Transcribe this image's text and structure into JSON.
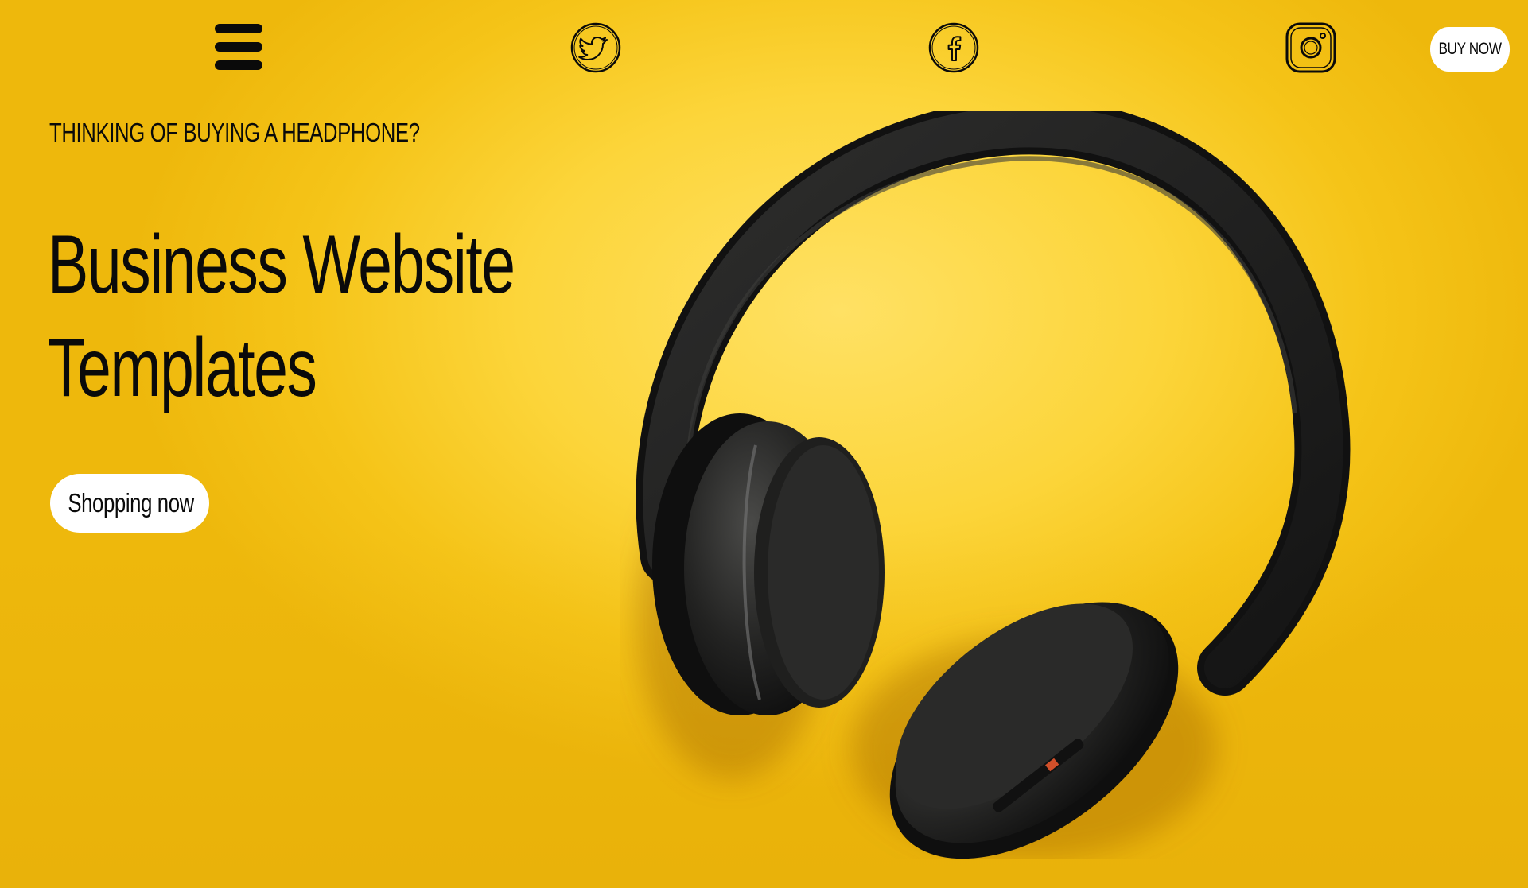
{
  "header": {
    "menu_icon": "hamburger-menu-icon",
    "social": [
      {
        "name": "twitter",
        "icon": "twitter-icon"
      },
      {
        "name": "facebook",
        "icon": "facebook-icon"
      },
      {
        "name": "instagram",
        "icon": "instagram-icon"
      }
    ],
    "buy_now_label": "BUY NOW"
  },
  "hero": {
    "eyebrow": "THINKING OF BUYING A HEADPHONE?",
    "headline_line1": "Business Website",
    "headline_line2": "Templates",
    "cta_label": "Shopping now",
    "image": "headphone-image"
  },
  "colors": {
    "background": "#fcd53a",
    "text": "#0a0a0a",
    "button_bg": "#ffffff"
  }
}
